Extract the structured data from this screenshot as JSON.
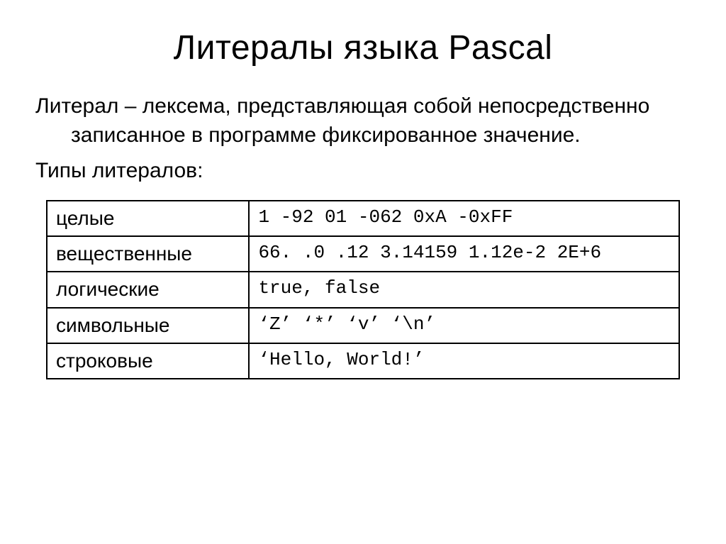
{
  "title": "Литералы языка Pascal",
  "definition": "Литерал – лексема, представляющая собой непосредственно записанное в программе фиксированное значение.",
  "types_label": "Типы литералов:",
  "table": {
    "rows": [
      {
        "label": "целые",
        "code": "1 -92 01 -062 0xA -0xFF"
      },
      {
        "label": "вещественные",
        "code": "66. .0 .12 3.14159 1.12e-2 2E+6"
      },
      {
        "label": "логические",
        "code": "true, false"
      },
      {
        "label": "символьные",
        "code": "‘Z’ ‘*’ ‘v’ ‘\\n’"
      },
      {
        "label": "строковые",
        "code": "‘Hello, World!’"
      }
    ]
  }
}
